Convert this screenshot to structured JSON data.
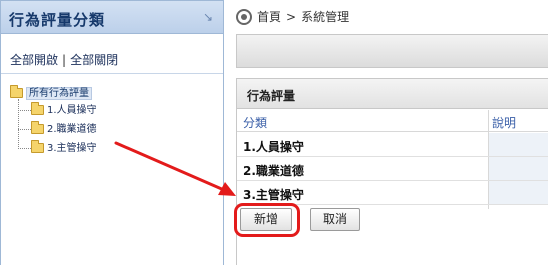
{
  "left_panel": {
    "title": "行為評量分類",
    "collapse_icon": "collapse-icon",
    "expand_all": "全部開啟",
    "separator": "|",
    "collapse_all": "全部關閉",
    "tree": {
      "root": "所有行為評量",
      "items": [
        {
          "label": "1.人員操守"
        },
        {
          "label": "2.職業道德"
        },
        {
          "label": "3.主管操守"
        }
      ]
    }
  },
  "breadcrumb": {
    "icon": "gear-icon",
    "home": "首頁",
    "separator": ">",
    "current": "系統管理"
  },
  "form": {
    "title": "行為評量",
    "columns": {
      "category": "分類",
      "description": "說明"
    },
    "rows": [
      {
        "category": "1.人員操守",
        "description": ""
      },
      {
        "category": "2.職業道德",
        "description": ""
      },
      {
        "category": "3.主管操守",
        "description": ""
      }
    ],
    "buttons": {
      "add": "新增",
      "cancel": "取消"
    }
  },
  "colors": {
    "header_blue": "#bcd0ea",
    "link_blue": "#3a5fa8",
    "annotation_red": "#e31b1b"
  }
}
